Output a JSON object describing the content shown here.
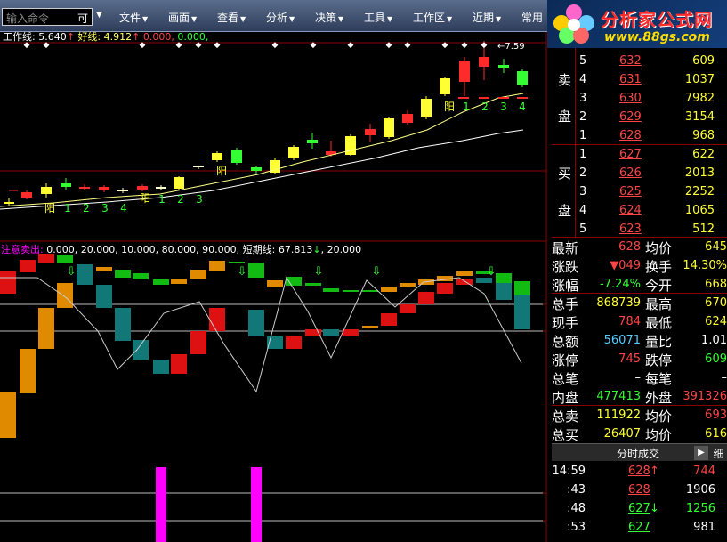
{
  "command": {
    "placeholder": "输入命令",
    "suffix": "可"
  },
  "menu": [
    {
      "label": "文件"
    },
    {
      "label": "画面"
    },
    {
      "label": "查看"
    },
    {
      "label": "分析"
    },
    {
      "label": "决策"
    },
    {
      "label": "工具"
    },
    {
      "label": "工作区"
    },
    {
      "label": "近期"
    },
    {
      "label": "常用"
    }
  ],
  "logo": {
    "title": "分析家公式网",
    "url": "www.88gs.com"
  },
  "main_indicator": {
    "label1": "工作线:",
    "value1": "5.640",
    "arrow1": "↑",
    "label2": "好线:",
    "value2": "4.912",
    "arrow2": "↑",
    "value3": "0.000,",
    "value4": "0.000,"
  },
  "sub_indicator": {
    "label": "注意卖出:",
    "values": "0.000, 20.000, 10.000, 80.000, 90.000,",
    "label2": "短期线:",
    "value2": "67.813",
    "arrow2": "↓",
    "value3": "20.000"
  },
  "price_note": "7.59",
  "chart_marks": {
    "yang": "阳",
    "counts_left": [
      "1",
      "2",
      "3",
      "4"
    ],
    "counts_mid": [
      "1",
      "2",
      "3"
    ],
    "counts_right": [
      "1",
      "2",
      "3",
      "4"
    ]
  },
  "colors": {
    "up": "#ff2a2a",
    "down": "#33ff33",
    "highlight": "#ffff33",
    "grid": "#8b0000",
    "magenta": "#ff00ff"
  },
  "order_book": {
    "sell_label": [
      "卖",
      "盘"
    ],
    "buy_label": [
      "买",
      "盘"
    ],
    "sell": [
      {
        "level": "5",
        "price": "632",
        "volume": "609"
      },
      {
        "level": "4",
        "price": "631",
        "volume": "1037"
      },
      {
        "level": "3",
        "price": "630",
        "volume": "7982"
      },
      {
        "level": "2",
        "price": "629",
        "volume": "3154"
      },
      {
        "level": "1",
        "price": "628",
        "volume": "968"
      }
    ],
    "buy": [
      {
        "level": "1",
        "price": "627",
        "volume": "622"
      },
      {
        "level": "2",
        "price": "626",
        "volume": "2013"
      },
      {
        "level": "3",
        "price": "625",
        "volume": "2252"
      },
      {
        "level": "4",
        "price": "624",
        "volume": "1065"
      },
      {
        "level": "5",
        "price": "623",
        "volume": "512"
      }
    ]
  },
  "quote": [
    {
      "l1": "最新",
      "v1": "628",
      "l2": "均价",
      "v2": "645"
    },
    {
      "l1": "涨跌",
      "v1": "▼049",
      "l2": "换手",
      "v2": "14.30%"
    },
    {
      "l1": "涨幅",
      "v1": "-7.24%",
      "l2": "今开",
      "v2": "668"
    },
    {
      "l1": "总手",
      "v1": "868739",
      "l2": "最高",
      "v2": "670"
    },
    {
      "l1": "现手",
      "v1": "784",
      "l2": "最低",
      "v2": "624"
    },
    {
      "l1": "总额",
      "v1": "56071",
      "l2": "量比",
      "v2": "1.01"
    },
    {
      "l1": "涨停",
      "v1": "745",
      "l2": "跌停",
      "v2": "609"
    },
    {
      "l1": "总笔",
      "v1": "–",
      "l2": "每笔",
      "v2": "–"
    },
    {
      "l1": "内盘",
      "v1": "477413",
      "l2": "外盘",
      "v2": "391326"
    },
    {
      "l1": "总卖",
      "v1": "111922",
      "l2": "均价",
      "v2": "693"
    },
    {
      "l1": "总买",
      "v1": "26407",
      "l2": "均价",
      "v2": "616"
    }
  ],
  "ticks": {
    "title": "分时成交",
    "detail": "细",
    "rows": [
      {
        "time": "14:59",
        "price": "628",
        "arrow": "↑",
        "volume": "744"
      },
      {
        "time": ":43",
        "price": "628",
        "arrow": "",
        "volume": "1906"
      },
      {
        "time": ":48",
        "price": "627",
        "arrow": "↓",
        "volume": "1256"
      },
      {
        "time": ":53",
        "price": "627",
        "arrow": "",
        "volume": "981"
      }
    ]
  }
}
